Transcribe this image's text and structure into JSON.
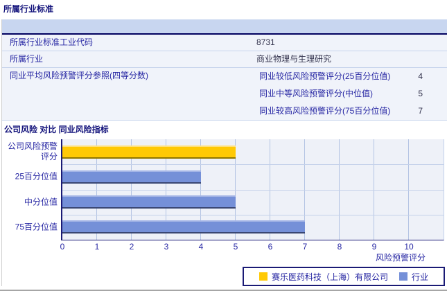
{
  "section1": {
    "title": "所属行业标准"
  },
  "industry_table": {
    "rows": [
      {
        "label": "所属行业标准工业代码",
        "value": "8731"
      },
      {
        "label": "所属行业",
        "value": "商业物理与生理研究"
      },
      {
        "label": "同业平均风险预警评分参照(四等分数)",
        "subrows": [
          {
            "label": "同业较低风险预警评分(25百分位值)",
            "value": "4"
          },
          {
            "label": "同业中等风险预警评分(中位值)",
            "value": "5"
          },
          {
            "label": "同业较高风险预警评分(75百分位值)",
            "value": "7"
          }
        ]
      }
    ]
  },
  "section2": {
    "title": "公司风险 对比 同业风险指标"
  },
  "chart_data": {
    "type": "bar",
    "orientation": "horizontal",
    "title": "公司风险 对比 同业风险指标",
    "categories": [
      "公司风险预警评分",
      "25百分位值",
      "中分位值",
      "75百分位值"
    ],
    "series": [
      {
        "name": "赛乐医药科技（上海）有限公司",
        "color": "#FFC905",
        "color_top": "#FFE07A",
        "color_bottom": "#8F7500",
        "points": [
          {
            "category": "公司风险预警评分",
            "value": 5
          }
        ]
      },
      {
        "name": "行业",
        "color": "#7590D8",
        "color_top": "#A4B5E6",
        "color_bottom": "#3A4773",
        "points": [
          {
            "category": "25百分位值",
            "value": 4
          },
          {
            "category": "中分位值",
            "value": 5
          },
          {
            "category": "75百分位值",
            "value": 7
          }
        ]
      }
    ],
    "xlabel": "风险预警评分",
    "xlim": [
      0,
      11
    ],
    "xticks": [
      0,
      1,
      2,
      3,
      4,
      5,
      6,
      7,
      8,
      9,
      10
    ],
    "grid": "vertical",
    "legend_position": "bottom",
    "plot_bg": "#EEF1F8",
    "gridline_color": "#B3C3E3",
    "axis_color": "#1A1A75"
  }
}
